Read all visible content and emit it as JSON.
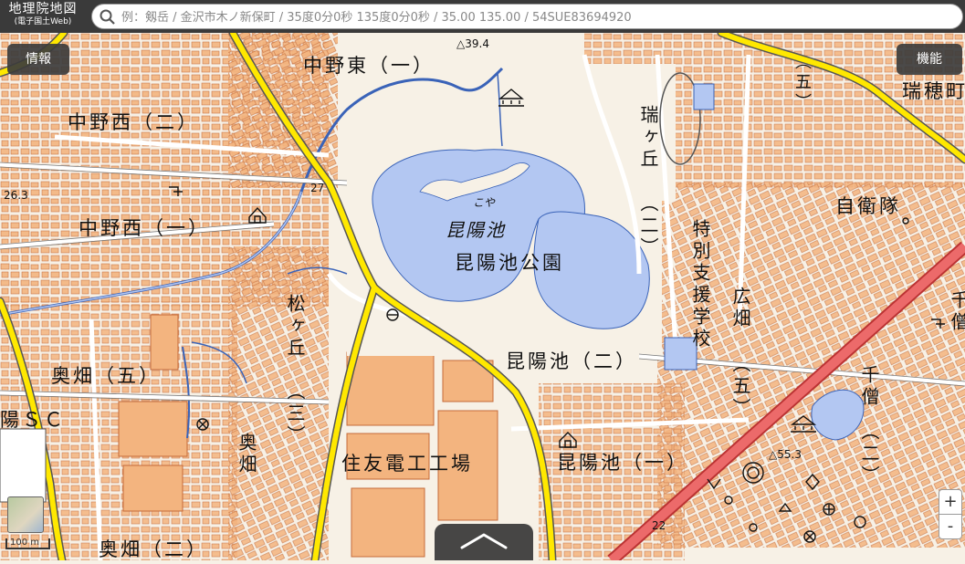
{
  "app": {
    "logo_title": "地理院地図",
    "logo_subtitle": "(電子国土Web)"
  },
  "search": {
    "placeholder": "例：剱岳 / 金沢市木ノ新保町 / 35度0分0秒 135度0分0秒 / 35.00 135.00 / 54SUE83694920"
  },
  "buttons": {
    "info_label": "情報",
    "function_label": "機能",
    "zoom_in_label": "+",
    "zoom_out_label": "-",
    "drawer_icon": "chevron-up-icon"
  },
  "scale_label": "100 m",
  "attribution": "",
  "map": {
    "labels": {
      "nakano_higashi_1": "中野東（一）",
      "nakano_nishi_2": "中野西（二）",
      "nakano_nishi_1": "中野西（一）",
      "koyaike_pond": "昆陽池",
      "koyaike_park": "昆陽池公園",
      "koya_small": "こや",
      "zuikeoka": "瑞ヶ丘",
      "zuikeoka_2": "（二）",
      "zuiho_cho": "瑞穂町",
      "jieitai": "自衛隊",
      "tokubetsu_shien_gakko": "特別支援学校",
      "hirohata": "広畑",
      "hirohata_5": "（五）",
      "matsugaoka": "松ヶ丘",
      "matsugaoka_3": "（三）",
      "koyaike_2": "昆陽池（二）",
      "koyaike_1": "昆陽池（一）",
      "okubata_5": "奥畑（五）",
      "okubata_v": "奥畑",
      "okubata_2": "奥畑（二）",
      "sumitomo": "住友電工工場",
      "yo_sc": "陽ＳＣ",
      "senzo": "千僧",
      "senzo_2": "（二）",
      "senzo_right": "千僧",
      "five_top": "（五）",
      "elev_26_3": "26.3",
      "elev_27": "27",
      "elev_39_4": "△39.4",
      "elev_55_3": "△55.3",
      "elev_22": "22"
    }
  },
  "colors": {
    "water": "#b3c7f2",
    "water_stroke": "#3a63b8",
    "road_major": "#ffe800",
    "road_highway": "#ec6a6a",
    "building": "#f3b47f",
    "building_stroke": "#c46a3a",
    "ground": "#f7f1e6",
    "toolbar": "#3a3a3a"
  }
}
